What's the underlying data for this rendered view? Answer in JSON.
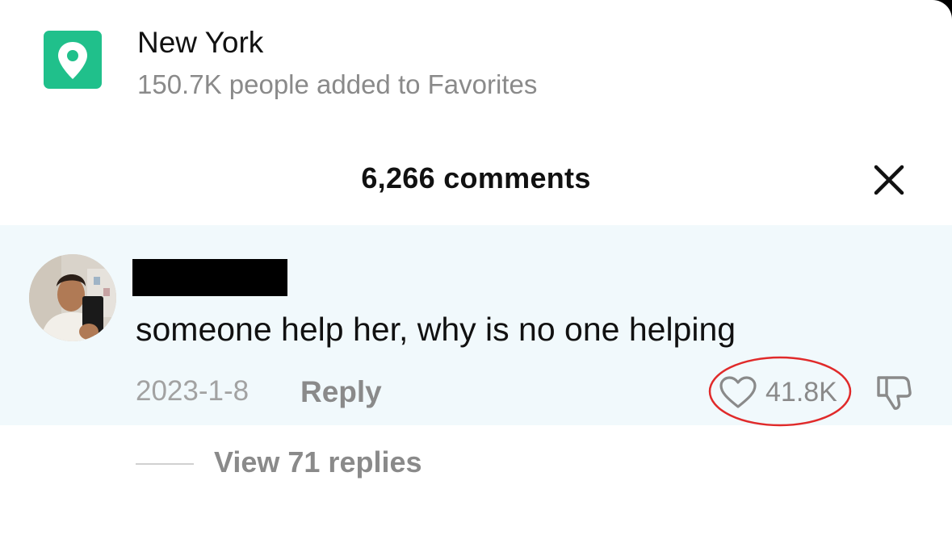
{
  "location": {
    "title": "New York",
    "subtitle": "150.7K people added to Favorites",
    "icon": "location-pin-icon",
    "badge_color": "#20c08b"
  },
  "comments": {
    "count_label": "6,266 comments",
    "close_icon": "close-icon"
  },
  "comment": {
    "text": "someone help her, why is no one helping",
    "date": "2023-1-8",
    "reply_label": "Reply",
    "like_count": "41.8K",
    "like_icon": "heart-outline-icon",
    "dislike_icon": "thumbs-down-icon",
    "card_background": "#f1f9fc",
    "highlight_color": "#e02a2a"
  },
  "replies": {
    "label": "View 71 replies"
  }
}
